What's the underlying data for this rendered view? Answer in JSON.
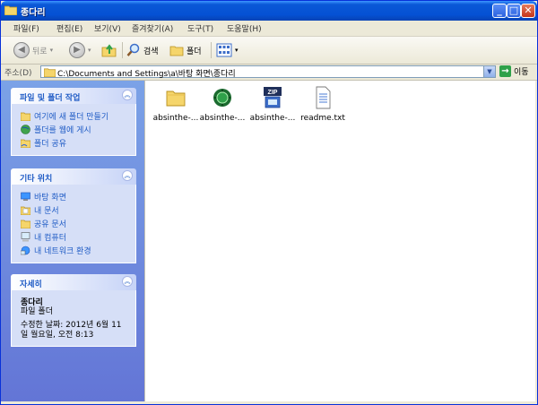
{
  "window": {
    "title": "종다리"
  },
  "menu": [
    {
      "label": "파일(F)"
    },
    {
      "label": "편집(E)"
    },
    {
      "label": "보기(V)"
    },
    {
      "label": "즐겨찾기(A)"
    },
    {
      "label": "도구(T)"
    },
    {
      "label": "도움말(H)"
    }
  ],
  "toolbar": {
    "back_label": "뒤로",
    "search_label": "검색",
    "folders_label": "폴더"
  },
  "address": {
    "label": "주소(D)",
    "value": "C:\\Documents and Settings\\a\\바탕 화면\\종다리",
    "go_label": "이동"
  },
  "panels": {
    "tasks": {
      "title": "파일 및 폴더 작업",
      "items": [
        {
          "label": "여기에 새 폴더 만들기"
        },
        {
          "label": "폴더를 웹에 게시"
        },
        {
          "label": "폴더 공유"
        }
      ]
    },
    "places": {
      "title": "기타 위치",
      "items": [
        {
          "label": "바탕 화면"
        },
        {
          "label": "내 문서"
        },
        {
          "label": "공유 문서"
        },
        {
          "label": "내 컴퓨터"
        },
        {
          "label": "내 네트워크 환경"
        }
      ]
    },
    "details": {
      "title": "자세히",
      "name": "종다리",
      "type": "파일 폴더",
      "modified_line1": "수정한 날짜: 2012년 6월 11",
      "modified_line2": "일 월요일, 오전 8:13"
    }
  },
  "files": [
    {
      "label": "absinthe-...",
      "icon": "folder-icon"
    },
    {
      "label": "absinthe-...",
      "icon": "absinthe-app-icon"
    },
    {
      "label": "absinthe-...",
      "icon": "zip-icon"
    },
    {
      "label": "readme.txt",
      "icon": "text-file-icon"
    }
  ],
  "zip_badge": "ZIP",
  "colors": {
    "title_bar": "#0551d4",
    "task_pane": "#6375d6",
    "link": "#215dc6"
  }
}
